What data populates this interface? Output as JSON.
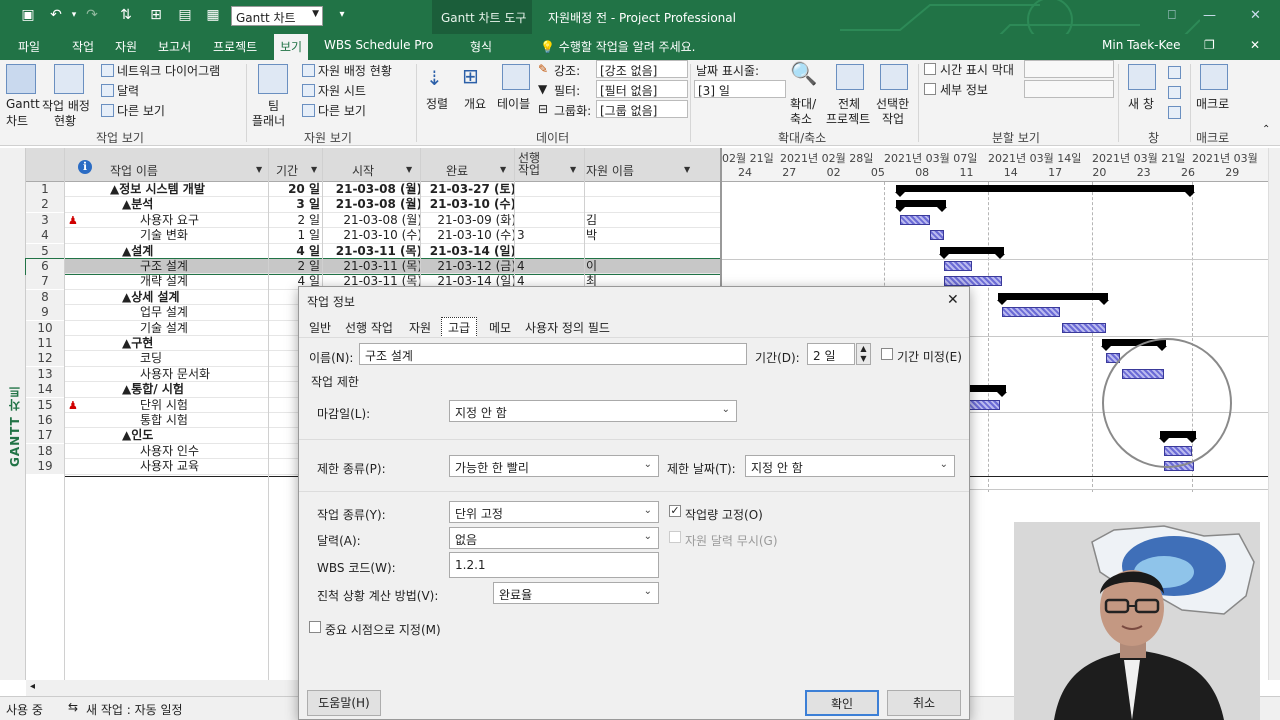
{
  "window": {
    "title": "자원배정 전 - Project Professional",
    "context_tab_group": "Gantt 차트 도구",
    "user": "Min Taek-Kee",
    "view_selector": "Gantt 차트"
  },
  "tabs": [
    "파일",
    "작업",
    "자원",
    "보고서",
    "프로젝트",
    "보기",
    "WBS Schedule Pro",
    "형식"
  ],
  "active_tab": "보기",
  "tell_me": "수행할 작업을 알려 주세요.",
  "ribbon": {
    "task_views": {
      "group": "작업 보기",
      "gantt": "Gantt",
      "gantt2": "차트",
      "usage": "작업 배정",
      "usage2": "현황",
      "network": "네트워크 다이어그램",
      "calendar": "달력",
      "other": "다른 보기"
    },
    "resource_views": {
      "group": "자원 보기",
      "team": "팀",
      "team2": "플래너",
      "usage": "자원 배정 현황",
      "sheet": "자원 시트",
      "other": "다른 보기"
    },
    "data": {
      "group": "데이터",
      "sort": "정렬",
      "outline": "개요",
      "tables": "테이블",
      "highlight_label": "강조:",
      "highlight_value": "[강조 없음]",
      "filter_label": "필터:",
      "filter_value": "[필터 없음]",
      "group_label": "그룹화:",
      "group_value": "[그룹 없음]"
    },
    "zoom": {
      "group": "확대/축소",
      "timescale_label": "날짜 표시줄:",
      "timescale_value": "[3] 일",
      "zoom": "확대/",
      "zoom2": "축소",
      "entire": "전체",
      "entire2": "프로젝트",
      "selected": "선택한",
      "selected2": "작업"
    },
    "split": {
      "group": "분할 보기",
      "timeline": "시간 표시 막대",
      "details": "세부 정보"
    },
    "window": {
      "group": "창",
      "new": "새 창"
    },
    "macros": {
      "group": "매크로",
      "label": "매크로"
    }
  },
  "sidebar_label": "GANTT 차트",
  "columns": {
    "info": "ℹ",
    "name": "작업 이름",
    "duration": "기간",
    "start": "시작",
    "finish": "완료",
    "predecessors": "선행 작업",
    "resources": "자원 이름"
  },
  "rows": [
    {
      "id": "1",
      "name": "▲정보 시스템 개발",
      "dur": "20 일",
      "start": "21-03-08 (월)",
      "finish": "21-03-27 (토)",
      "pred": "",
      "res": "",
      "level": 0,
      "bold": true
    },
    {
      "id": "2",
      "name": "▲분석",
      "dur": "3 일",
      "start": "21-03-08 (월)",
      "finish": "21-03-10 (수)",
      "pred": "",
      "res": "",
      "level": 1,
      "bold": true
    },
    {
      "id": "3",
      "name": "사용자 요구",
      "dur": "2 일",
      "start": "21-03-08 (월)",
      "finish": "21-03-09 (화)",
      "pred": "",
      "res": "김",
      "level": 2,
      "bold": false,
      "flag": true
    },
    {
      "id": "4",
      "name": "기술 변화",
      "dur": "1 일",
      "start": "21-03-10 (수)",
      "finish": "21-03-10 (수)",
      "pred": "3",
      "res": "박",
      "level": 2,
      "bold": false
    },
    {
      "id": "5",
      "name": "▲설계",
      "dur": "4 일",
      "start": "21-03-11 (목)",
      "finish": "21-03-14 (일)",
      "pred": "",
      "res": "",
      "level": 1,
      "bold": true
    },
    {
      "id": "6",
      "name": "구조 설계",
      "dur": "2 일",
      "start": "21-03-11 (목)",
      "finish": "21-03-12 (금)",
      "pred": "4",
      "res": "이",
      "level": 2,
      "bold": false,
      "selected": true
    },
    {
      "id": "7",
      "name": "개략 설계",
      "dur": "4 일",
      "start": "21-03-11 (목)",
      "finish": "21-03-14 (일)",
      "pred": "4",
      "res": "최",
      "level": 2,
      "bold": false
    },
    {
      "id": "8",
      "name": "▲상세 설계",
      "dur": "",
      "start": "",
      "finish": "",
      "pred": "",
      "res": "",
      "level": 1,
      "bold": true
    },
    {
      "id": "9",
      "name": "업무 설계",
      "dur": "",
      "start": "",
      "finish": "",
      "pred": "",
      "res": "",
      "level": 2,
      "bold": false
    },
    {
      "id": "10",
      "name": "기술 설계",
      "dur": "",
      "start": "",
      "finish": "",
      "pred": "",
      "res": "",
      "level": 2,
      "bold": false
    },
    {
      "id": "11",
      "name": "▲구현",
      "dur": "",
      "start": "",
      "finish": "",
      "pred": "",
      "res": "",
      "level": 1,
      "bold": true
    },
    {
      "id": "12",
      "name": "코딩",
      "dur": "",
      "start": "",
      "finish": "",
      "pred": "",
      "res": "",
      "level": 2,
      "bold": false
    },
    {
      "id": "13",
      "name": "사용자 문서화",
      "dur": "",
      "start": "",
      "finish": "",
      "pred": "",
      "res": "",
      "level": 2,
      "bold": false
    },
    {
      "id": "14",
      "name": "▲통합/ 시험",
      "dur": "",
      "start": "",
      "finish": "",
      "pred": "",
      "res": "",
      "level": 1,
      "bold": true
    },
    {
      "id": "15",
      "name": "단위 시험",
      "dur": "",
      "start": "",
      "finish": "",
      "pred": "",
      "res": "",
      "level": 2,
      "bold": false,
      "flag": true
    },
    {
      "id": "16",
      "name": "통합 시험",
      "dur": "",
      "start": "",
      "finish": "",
      "pred": "",
      "res": "",
      "level": 2,
      "bold": false
    },
    {
      "id": "17",
      "name": "▲인도",
      "dur": "",
      "start": "",
      "finish": "",
      "pred": "",
      "res": "",
      "level": 1,
      "bold": true
    },
    {
      "id": "18",
      "name": "사용자 인수",
      "dur": "",
      "start": "",
      "finish": "",
      "pred": "",
      "res": "",
      "level": 2,
      "bold": false
    },
    {
      "id": "19",
      "name": "사용자 교육",
      "dur": "",
      "start": "",
      "finish": "",
      "pred": "",
      "res": "",
      "level": 2,
      "bold": false
    }
  ],
  "timescale": {
    "weeks": [
      "02월 21일",
      "2021년 02월 28일",
      "2021년 03월 07일",
      "2021년 03월 14일",
      "2021년 03월 21일",
      "2021년 03월"
    ],
    "days": [
      "24",
      "27",
      "02",
      "05",
      "08",
      "11",
      "14",
      "17",
      "20",
      "23",
      "26",
      "29"
    ]
  },
  "dialog": {
    "title": "작업 정보",
    "tabs": [
      "일반",
      "선행 작업",
      "자원",
      "고급",
      "메모",
      "사용자 정의 필드"
    ],
    "active_tab": "고급",
    "name_label": "이름(N):",
    "name_value": "구조 설계",
    "duration_label": "기간(D):",
    "duration_value": "2 일",
    "estimated_label": "기간 미정(E)",
    "constrain_section": "작업 제한",
    "deadline_label": "마감일(L):",
    "deadline_value": "지정 안 함",
    "constraint_type_label": "제한 종류(P):",
    "constraint_type_value": "가능한 한 빨리",
    "constraint_date_label": "제한 날짜(T):",
    "constraint_date_value": "지정 안 함",
    "task_type_label": "작업 종류(Y):",
    "task_type_value": "단위 고정",
    "effort_driven_label": "작업량 고정(O)",
    "calendar_label": "달력(A):",
    "calendar_value": "없음",
    "ignore_res_cal_label": "자원 달력 무시(G)",
    "wbs_label": "WBS 코드(W):",
    "wbs_value": "1.2.1",
    "earned_value_label": "진척 상황 계산 방법(V):",
    "earned_value_value": "완료율",
    "milestone_label": "중요 시점으로 지정(M)",
    "help_button": "도움말(H)",
    "ok_button": "확인",
    "cancel_button": "취소"
  },
  "statusbar": {
    "mode": "사용 중",
    "new_tasks": "새 작업 : 자동 일정"
  }
}
